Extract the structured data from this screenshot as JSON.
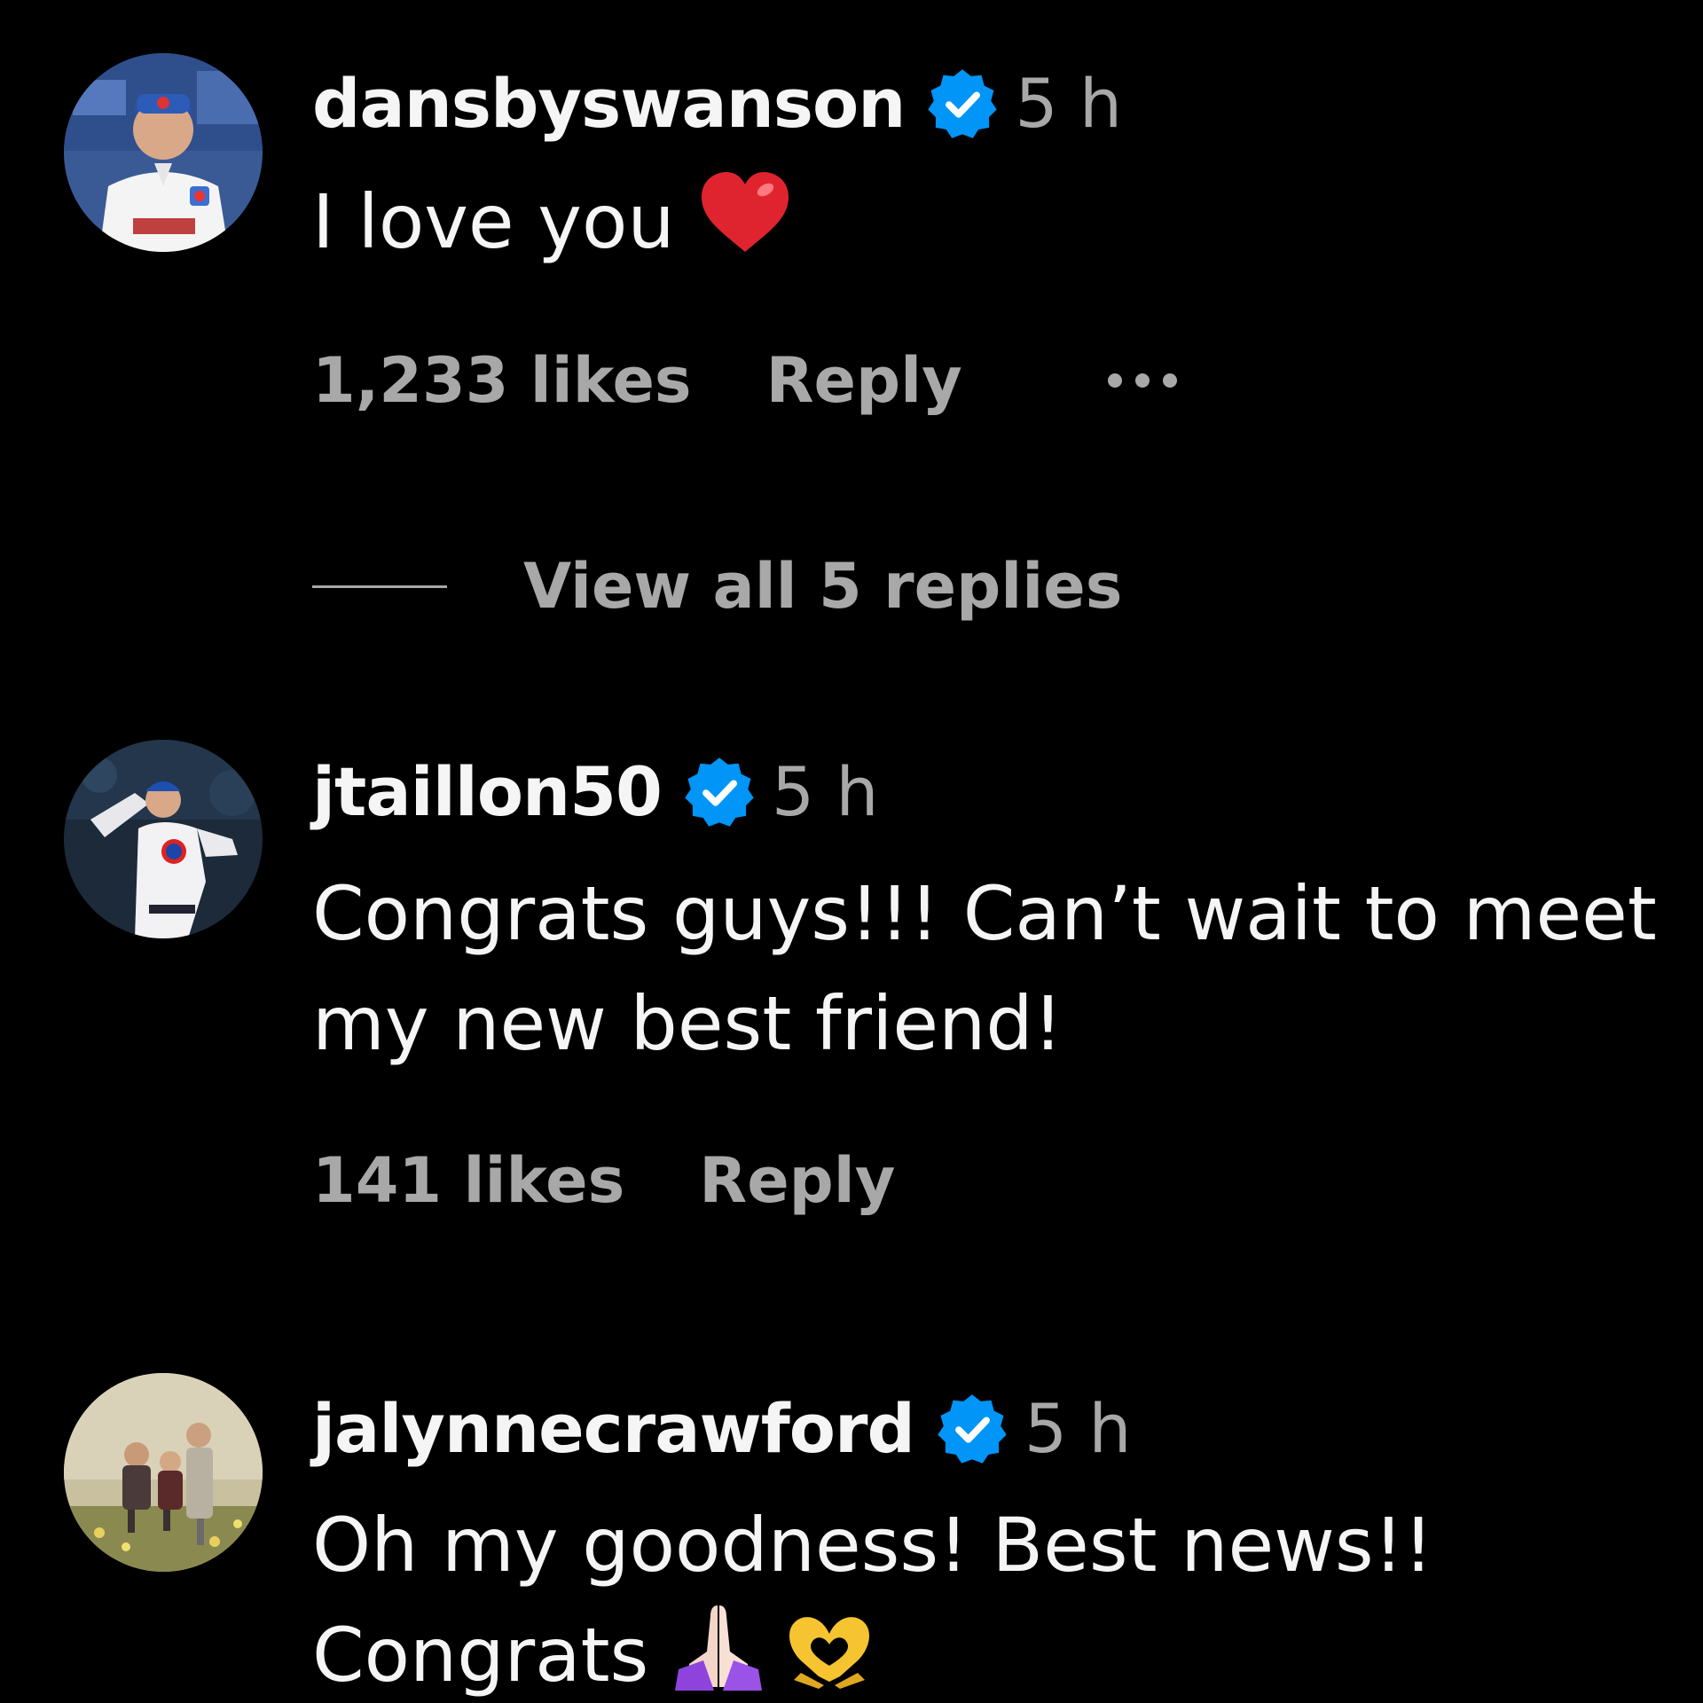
{
  "comments": [
    {
      "username": "dansbyswanson",
      "time": "5 h",
      "text": "I love you",
      "emoji": "red-heart",
      "likes": "1,233 likes",
      "reply": "Reply",
      "view_replies": "View all 5 replies"
    },
    {
      "username": "jtaillon50",
      "time": "5 h",
      "text_line1": "Congrats guys!!! Can’t wait to meet",
      "text_line2": "my new best friend!",
      "likes": "141 likes",
      "reply": "Reply"
    },
    {
      "username": "jalynnecrawford",
      "time": "5 h",
      "text_line1": "Oh my goodness! Best news!!",
      "text_line2": "Congrats",
      "emojis": [
        "folded-hands",
        "heart-hands"
      ]
    }
  ],
  "colors": {
    "background": "#000000",
    "primary_text": "#f5f5f5",
    "secondary_text": "#a8a8a8",
    "verified_badge": "#0095f6",
    "heart": "#e0242f"
  }
}
